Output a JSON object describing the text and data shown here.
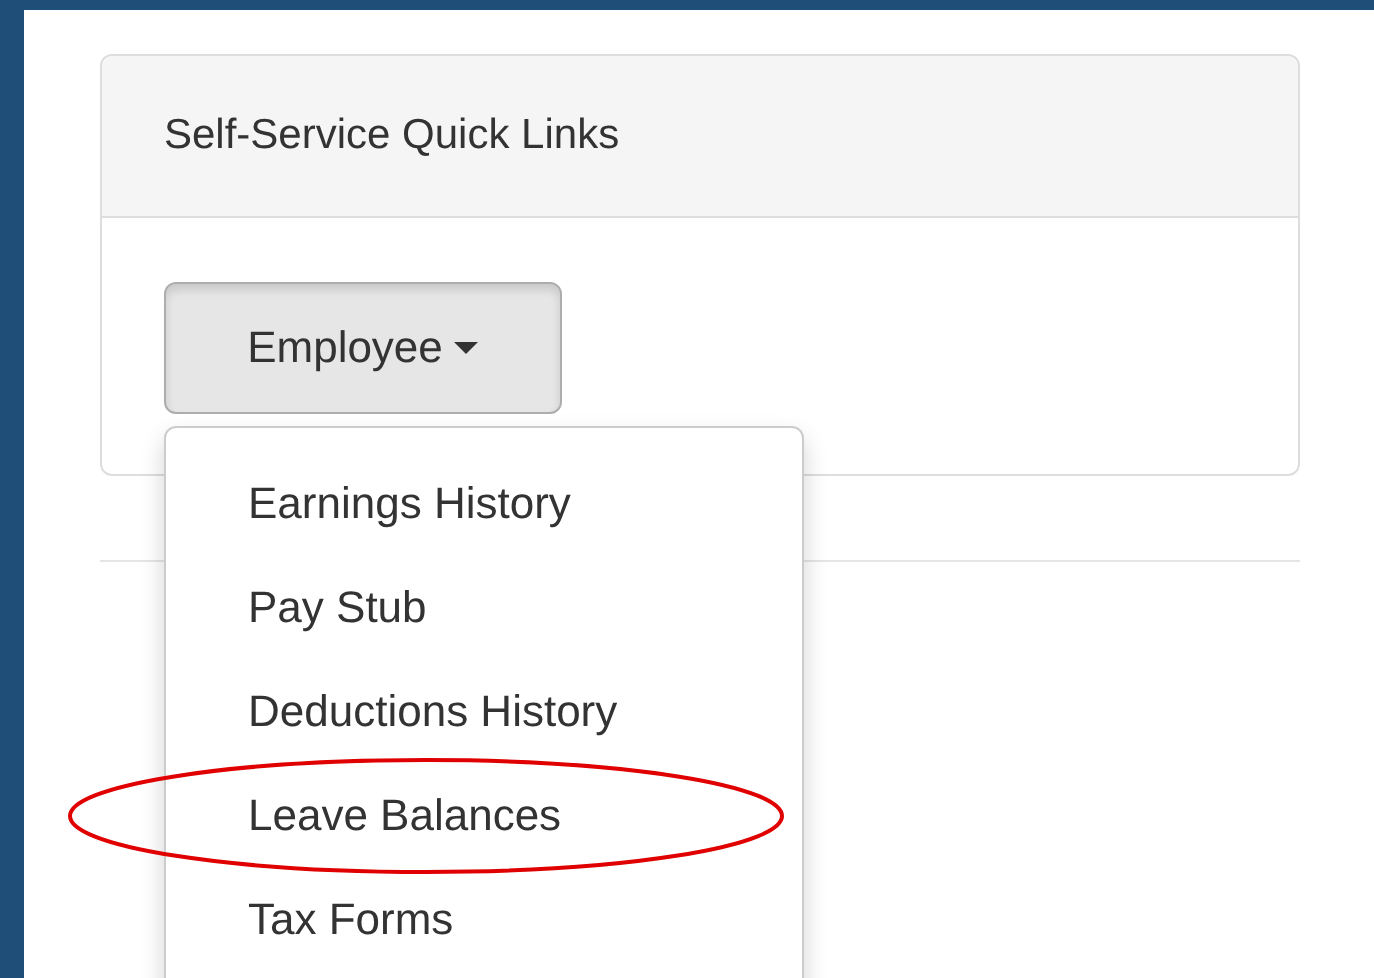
{
  "panel": {
    "title": "Self-Service Quick Links"
  },
  "dropdown": {
    "label": "Employee",
    "expanded": true,
    "items": [
      {
        "label": "Earnings History",
        "highlighted": false
      },
      {
        "label": "Pay Stub",
        "highlighted": false
      },
      {
        "label": "Deductions History",
        "highlighted": false
      },
      {
        "label": "Leave Balances",
        "highlighted": true
      },
      {
        "label": "Tax Forms",
        "highlighted": false
      }
    ]
  }
}
